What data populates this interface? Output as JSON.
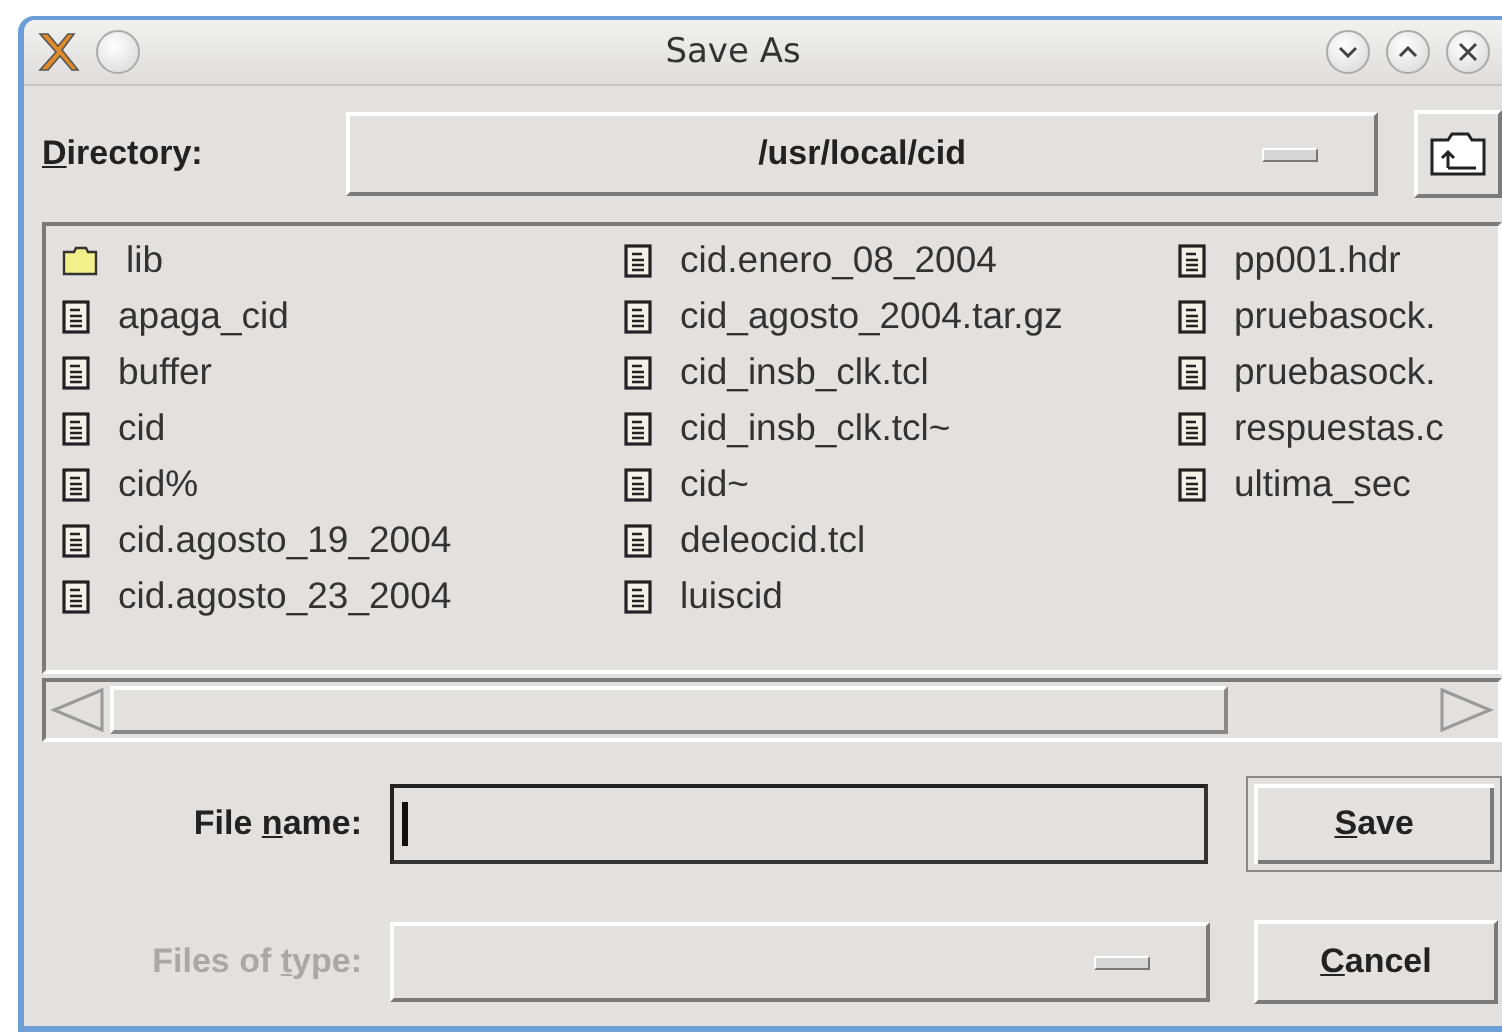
{
  "window": {
    "title": "Save As"
  },
  "directory": {
    "label": {
      "key": "D",
      "post": "irectory:"
    },
    "value": "/usr/local/cid"
  },
  "files": [
    [
      {
        "name": "lib",
        "kind": "folder"
      },
      {
        "name": "apaga_cid",
        "kind": "file"
      },
      {
        "name": "buffer",
        "kind": "file"
      },
      {
        "name": "cid",
        "kind": "file"
      },
      {
        "name": "cid%",
        "kind": "file"
      },
      {
        "name": "cid.agosto_19_2004",
        "kind": "file"
      },
      {
        "name": "cid.agosto_23_2004",
        "kind": "file"
      }
    ],
    [
      {
        "name": "cid.enero_08_2004",
        "kind": "file"
      },
      {
        "name": "cid_agosto_2004.tar.gz",
        "kind": "file"
      },
      {
        "name": "cid_insb_clk.tcl",
        "kind": "file"
      },
      {
        "name": "cid_insb_clk.tcl~",
        "kind": "file"
      },
      {
        "name": "cid~",
        "kind": "file"
      },
      {
        "name": "deleocid.tcl",
        "kind": "file"
      },
      {
        "name": "luiscid",
        "kind": "file"
      }
    ],
    [
      {
        "name": "pp001.hdr",
        "kind": "file"
      },
      {
        "name": "pruebasock.",
        "kind": "file"
      },
      {
        "name": "pruebasock.",
        "kind": "file"
      },
      {
        "name": "respuestas.c",
        "kind": "file"
      },
      {
        "name": "ultima_sec",
        "kind": "file"
      }
    ]
  ],
  "file_name": {
    "label": {
      "pre": "File ",
      "key": "n",
      "post": "ame:"
    },
    "disabled": false
  },
  "file_type": {
    "label": {
      "pre": "Files of ",
      "key": "t",
      "post": "ype:"
    },
    "disabled": true
  },
  "buttons": [
    {
      "label": {
        "key": "S",
        "post": "ave"
      },
      "default": true
    },
    {
      "label": {
        "key": "C",
        "post": "ancel"
      },
      "default": false
    }
  ]
}
